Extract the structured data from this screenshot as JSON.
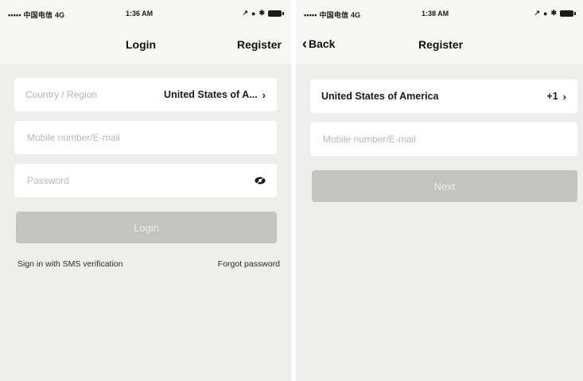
{
  "login_screen": {
    "status": {
      "carrier": "••••• 中国电信  4G",
      "time": "1:36 AM"
    },
    "nav": {
      "title": "Login",
      "right_action": "Register"
    },
    "country_field": {
      "label": "Country / Region",
      "value": "United States of A...",
      "chevron": "›"
    },
    "account_field": {
      "placeholder": "Mobile number/E-mail"
    },
    "password_field": {
      "placeholder": "Password",
      "icon": "eye-icon"
    },
    "login_button": {
      "label": "Login"
    },
    "links": {
      "sms_signin": "Sign in with SMS verification",
      "forgot_password": "Forgot password"
    }
  },
  "register_screen": {
    "status": {
      "carrier": "••••• 中国电信  4G",
      "time": "1:38 AM"
    },
    "nav": {
      "back_label": "Back",
      "title": "Register"
    },
    "country_field": {
      "value": "United States of America",
      "code": "+1",
      "chevron": "›"
    },
    "account_field": {
      "placeholder": "Mobile number/E-mail"
    },
    "next_button": {
      "label": "Next"
    }
  },
  "colors": {
    "background": "#eeeeec",
    "field_bg": "#ffffff",
    "button_disabled": "#c3c3c1",
    "text_dark": "#1a1a1a",
    "placeholder": "#b8b8b8"
  }
}
